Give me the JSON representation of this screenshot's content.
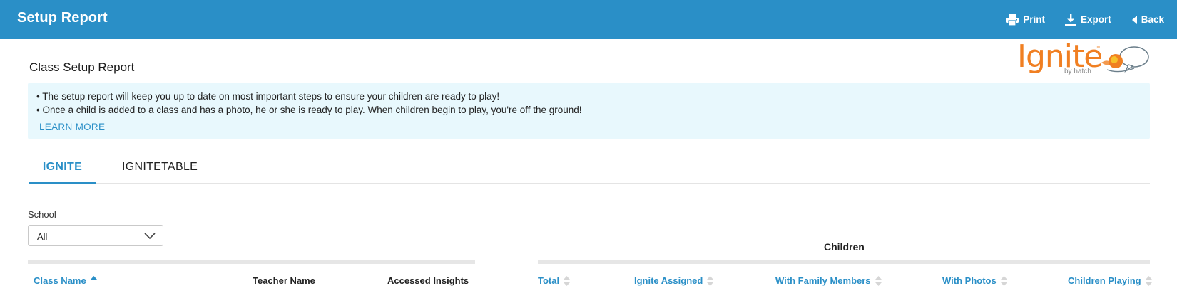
{
  "header": {
    "title": "Setup Report",
    "actions": {
      "print": "Print",
      "export": "Export",
      "back": "Back"
    }
  },
  "page": {
    "heading": "Class Setup Report"
  },
  "logo": {
    "word": "Ignite",
    "trademark": "™",
    "byline": "by hatch"
  },
  "info": {
    "lines": [
      "• The setup report will keep you up to date on most important steps to ensure your children are ready to play!",
      "• Once a child is added to a class and has a photo, he or she is ready to play. When children begin to play, you're off the ground!"
    ],
    "learn_more": "LEARN MORE"
  },
  "tabs": [
    {
      "label": "IGNITE",
      "active": true
    },
    {
      "label": "IGNITETABLE",
      "active": false
    }
  ],
  "filters": {
    "school": {
      "label": "School",
      "value": "All"
    }
  },
  "table": {
    "group_heading": "Children",
    "columns": [
      {
        "label": "Class Name",
        "sortable": true,
        "sort": "asc"
      },
      {
        "label": "Teacher Name",
        "sortable": false
      },
      {
        "label": "Accessed Insights",
        "sortable": false
      },
      {
        "label": "Total",
        "sortable": true
      },
      {
        "label": "Ignite Assigned",
        "sortable": true
      },
      {
        "label": "With Family Members",
        "sortable": true
      },
      {
        "label": "With Photos",
        "sortable": true
      },
      {
        "label": "Children Playing",
        "sortable": true
      }
    ]
  },
  "colors": {
    "brand_blue": "#2a8fc7",
    "info_background": "#e8f8fd",
    "logo_orange": "#f07f22"
  }
}
